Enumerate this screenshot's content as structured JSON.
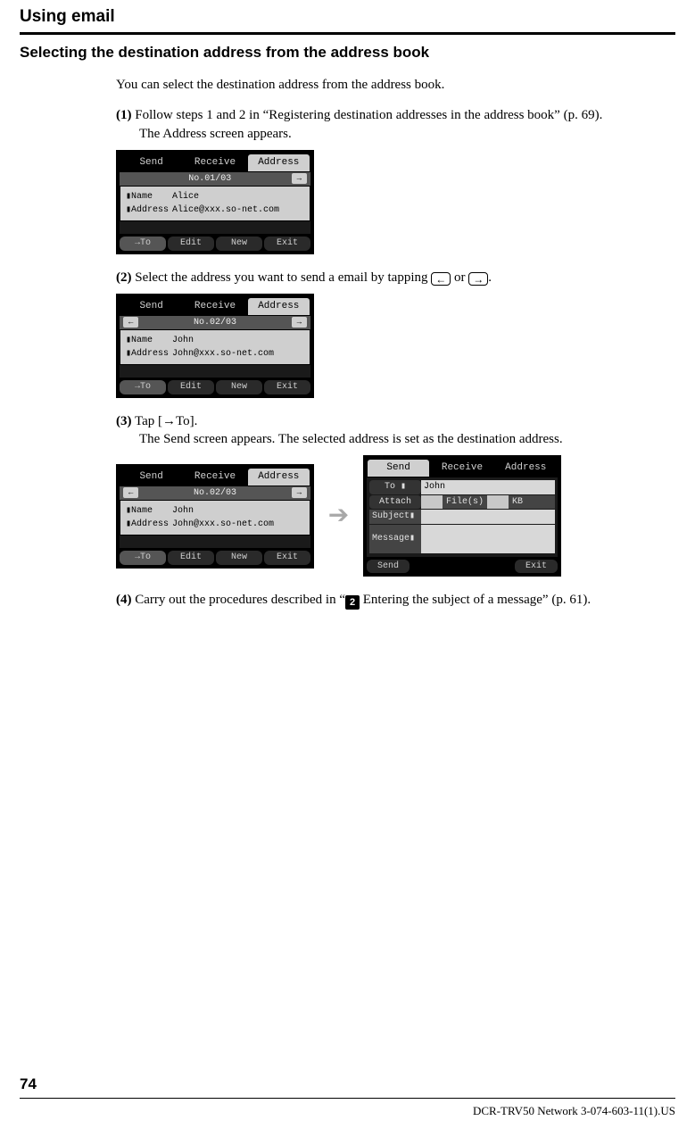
{
  "chapter_title": "Using email",
  "section_title": "Selecting the destination address from the address book",
  "intro": "You can select the destination address from the address book.",
  "steps": {
    "s1": {
      "num": "(1)",
      "text": "Follow steps 1 and 2 in “Registering destination addresses in the address book” (p. 69).",
      "sub": "The Address screen appears."
    },
    "s2": {
      "num": "(2)",
      "text_a": "Select the address you want to send a email by tapping ",
      "text_b": " or ",
      "text_c": "."
    },
    "s3": {
      "num": "(3)",
      "text": "Tap [→To].",
      "sub": "The Send screen appears. The selected address is set as the destination address."
    },
    "s4": {
      "num": "(4)",
      "text_a": "Carry out the procedures described in “",
      "text_b": " Entering the subject of a message” (p. 61)."
    }
  },
  "device": {
    "tabs": {
      "send": "Send",
      "receive": "Receive",
      "address": "Address"
    },
    "buttons": {
      "to": "→To",
      "edit": "Edit",
      "new": "New",
      "exit": "Exit",
      "send": "Send"
    },
    "labels": {
      "name": "▮Name",
      "addr": "▮Address"
    },
    "card1": {
      "header": "No.01/03",
      "name": "Alice",
      "addr": "Alice@xxx.so-net.com"
    },
    "card2": {
      "header": "No.02/03",
      "name": "John",
      "addr": "John@xxx.so-net.com"
    },
    "sendform": {
      "to_label": "To ▮",
      "to_value": "John",
      "attach_label": "Attach",
      "files_label": "File(s)",
      "kb_label": "KB",
      "subject_label": "Subject▮",
      "message_label": "Message▮"
    }
  },
  "inline": {
    "arrow_left": "←",
    "arrow_right": "→",
    "badge2": "2"
  },
  "page_number": "74",
  "footer_id": "DCR-TRV50 Network 3-074-603-11(1).US"
}
